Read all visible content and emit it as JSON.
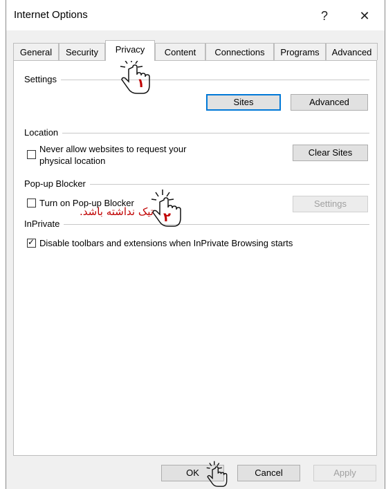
{
  "window": {
    "title": "Internet Options",
    "help": "?",
    "close": "✕"
  },
  "tabs": [
    {
      "label": "General"
    },
    {
      "label": "Security"
    },
    {
      "label": "Privacy"
    },
    {
      "label": "Content"
    },
    {
      "label": "Connections"
    },
    {
      "label": "Programs"
    },
    {
      "label": "Advanced"
    }
  ],
  "settings": {
    "header": "Settings",
    "sites_button": "Sites",
    "advanced_button": "Advanced"
  },
  "location": {
    "header": "Location",
    "never_allow_line1": "Never allow websites to request your",
    "never_allow_line2": "physical location",
    "clear_sites_button": "Clear Sites"
  },
  "popup": {
    "header": "Pop-up Blocker",
    "turn_on_label": "Turn on Pop-up Blocker",
    "settings_button": "Settings"
  },
  "inprivate": {
    "header": "InPrivate",
    "disable_toolbars_label": "Disable toolbars and extensions when InPrivate Browsing starts",
    "checkmark": "✓"
  },
  "footer": {
    "ok_button": "OK",
    "cancel_button": "Cancel",
    "apply_button": "Apply"
  },
  "annotations": {
    "note_text": "تیک نداشته باشد.",
    "step1": "۱",
    "step2": "۲"
  }
}
